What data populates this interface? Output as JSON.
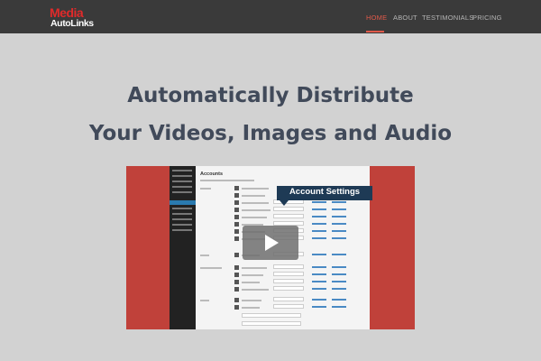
{
  "header": {
    "logo": {
      "line1": "Media",
      "line2": "AutoLinks"
    },
    "nav": [
      {
        "label": "HOME",
        "active": true
      },
      {
        "label": "ABOUT",
        "active": false
      },
      {
        "label": "TESTIMONIALS",
        "active": false
      },
      {
        "label": "PRICING",
        "active": false
      }
    ]
  },
  "hero": {
    "title_line1": "Automatically Distribute",
    "title_line2": "Your Videos, Images and Audio"
  },
  "video": {
    "banner": "Account Settings",
    "screenshot_title": "Accounts",
    "play_icon": "play-icon"
  },
  "colors": {
    "topbar": "#3a3a3a",
    "accent": "#e05a4a",
    "logo_red": "#e02a2a",
    "headline": "#414a5a",
    "video_bg": "#c0413a",
    "banner": "#1e3a55"
  }
}
